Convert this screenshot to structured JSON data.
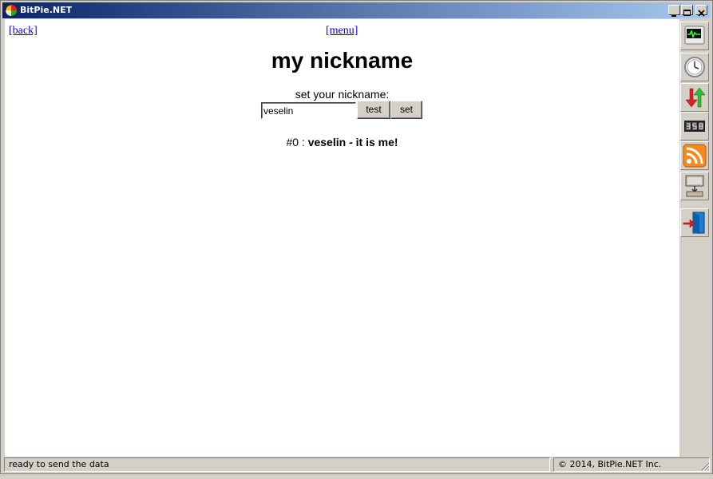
{
  "window": {
    "title": "BitPie.NET"
  },
  "nav": {
    "back_label": "[back]",
    "menu_label": "[menu]"
  },
  "page": {
    "title": "my nickname",
    "prompt": "set your nickname:"
  },
  "form": {
    "nickname_value": "veselin",
    "test_label": "test",
    "set_label": "set"
  },
  "result": {
    "index": "#0",
    "separator": ":",
    "name": "veselin",
    "note": "- it is me!"
  },
  "toolbar": {
    "icons": [
      "monitor-icon",
      "clock-icon",
      "transfer-arrows-icon",
      "counter-icon",
      "rss-icon",
      "network-icon",
      "exit-icon"
    ]
  },
  "status": {
    "message": "ready to send the data",
    "copyright": "© 2014, BitPie.NET Inc."
  }
}
